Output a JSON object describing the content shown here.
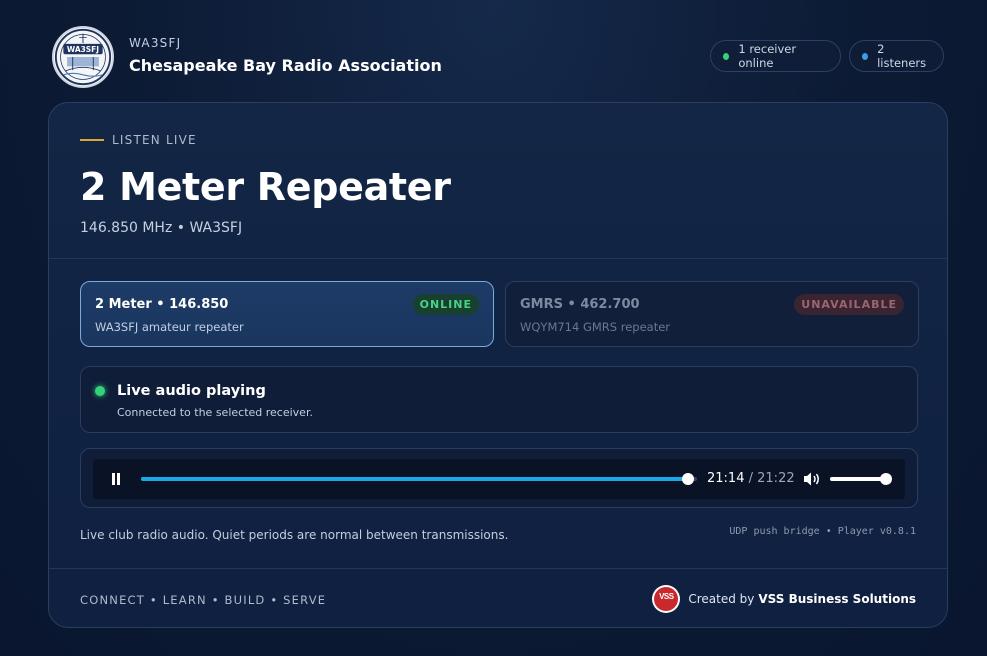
{
  "header": {
    "callsign": "WA3SFJ",
    "org_name": "Chesapeake Bay Radio Association",
    "logo_text": "WA3SFJ",
    "receivers_online": "1 receiver online",
    "listeners": "2 listeners"
  },
  "hero": {
    "eyebrow": "LISTEN LIVE",
    "title": "2 Meter Repeater",
    "subtitle": "146.850 MHz • WA3SFJ"
  },
  "receivers": [
    {
      "name": "2 Meter • 146.850",
      "desc": "WA3SFJ amateur repeater",
      "status": "ONLINE",
      "selected": true
    },
    {
      "name": "GMRS • 462.700",
      "desc": "WQYM714 GMRS repeater",
      "status": "UNAVAILABLE",
      "selected": false
    }
  ],
  "status": {
    "title": "Live audio playing",
    "desc": "Connected to the selected receiver."
  },
  "player": {
    "current_time": "21:14",
    "separator": "/",
    "duration": "21:22",
    "progress": 0.984,
    "volume": 1.0
  },
  "footer": {
    "note": "Live club radio audio. Quiet periods are normal between transmissions.",
    "version": "UDP push bridge • Player v0.8.1",
    "motto": "CONNECT • LEARN • BUILD • SERVE",
    "credit_prefix": "Created by",
    "credit_name": "VSS Business Solutions",
    "credit_logo_text": "VSS"
  },
  "colors": {
    "accent": "#1aa8e6",
    "online_dot": "#34d27a",
    "listener_dot": "#3d9be9",
    "eyebrow_bar": "#d9a63a"
  },
  "icons": {
    "pause": "pause-icon",
    "volume": "volume-icon",
    "status_dot": "status-dot-icon"
  }
}
